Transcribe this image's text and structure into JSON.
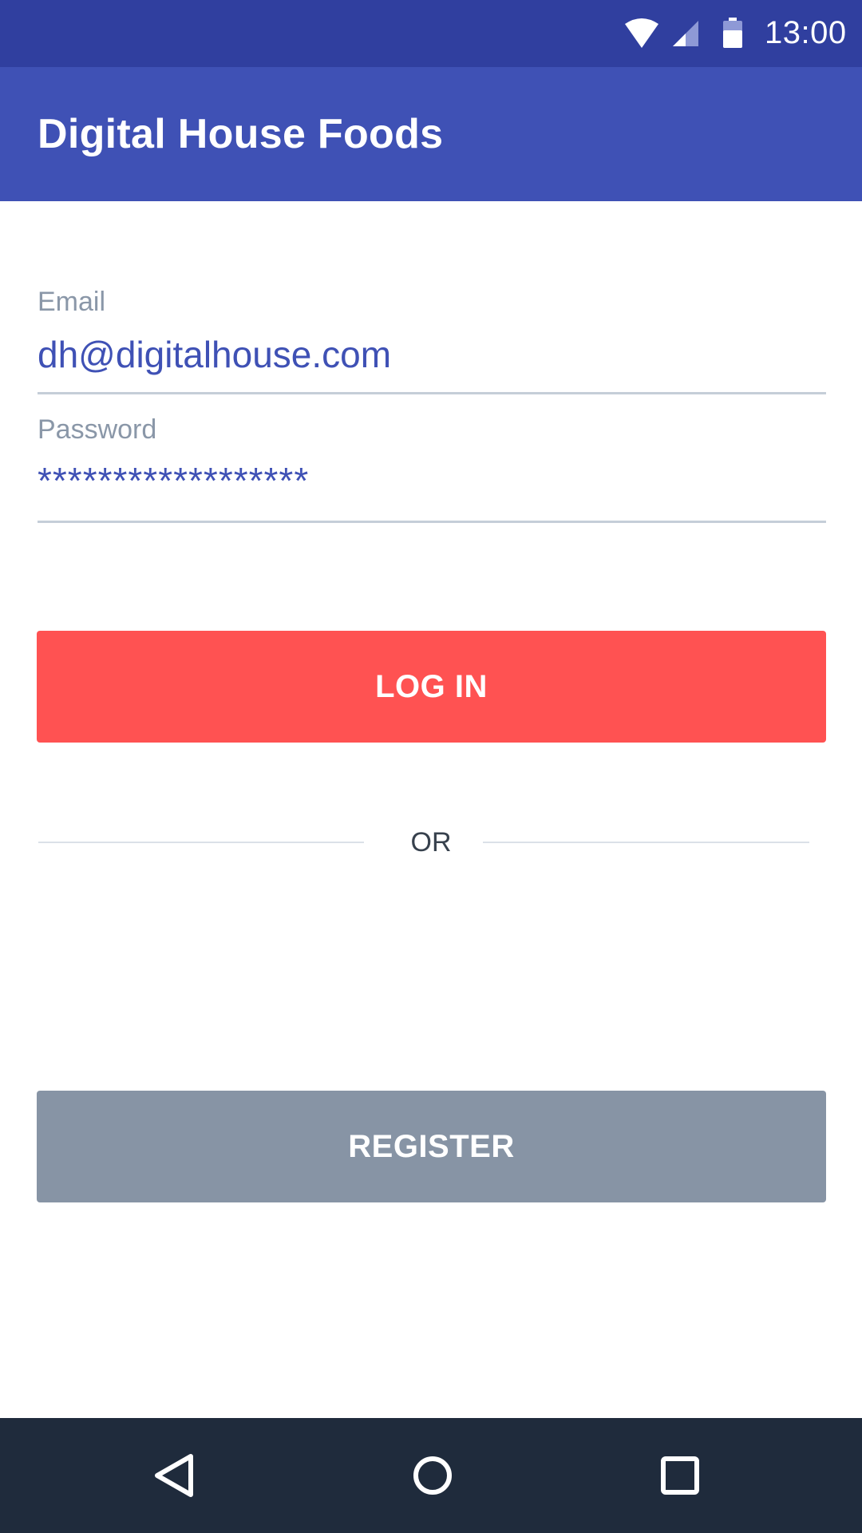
{
  "status_bar": {
    "time": "13:00",
    "icons": [
      "wifi-icon",
      "signal-icon",
      "battery-icon"
    ]
  },
  "app_bar": {
    "title": "Digital House Foods"
  },
  "form": {
    "email": {
      "label": "Email",
      "value": "dh@digitalhouse.com"
    },
    "password": {
      "label": "Password",
      "value": "******************"
    }
  },
  "actions": {
    "login_label": "LOG IN",
    "or_label": "OR",
    "register_label": "REGISTER"
  },
  "nav_bar": {
    "icons": [
      "back-icon",
      "home-icon",
      "recents-icon"
    ]
  },
  "colors": {
    "status_bar": "#303f9f",
    "primary": "#3f51b5",
    "login_button": "#ff5252",
    "register_button": "#8794a5",
    "nav_bar": "#1f2b3c"
  }
}
